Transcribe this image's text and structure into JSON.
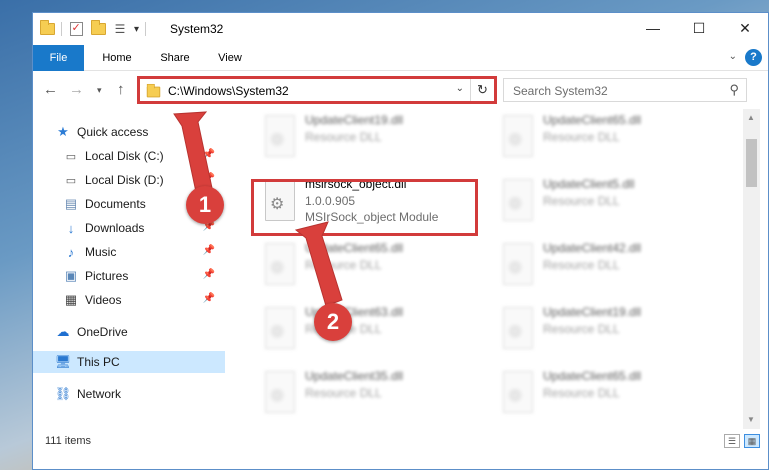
{
  "window": {
    "title": "System32",
    "controls": {
      "minimize": "—",
      "maximize": "☐",
      "close": "✕"
    }
  },
  "ribbon": {
    "tabs": [
      "File",
      "Home",
      "Share",
      "View"
    ],
    "help": "?"
  },
  "navigation": {
    "address_path": "C:\\Windows\\System32",
    "search_placeholder": "Search System32"
  },
  "sidebar": {
    "items": [
      {
        "label": "Quick access",
        "icon": "star-icon"
      },
      {
        "label": "Local Disk (C:)",
        "icon": "drive-icon",
        "pinned": true
      },
      {
        "label": "Local Disk (D:)",
        "icon": "drive-icon",
        "pinned": true
      },
      {
        "label": "Documents",
        "icon": "documents-icon",
        "pinned": true
      },
      {
        "label": "Downloads",
        "icon": "download-icon",
        "pinned": true
      },
      {
        "label": "Music",
        "icon": "music-icon",
        "pinned": true
      },
      {
        "label": "Pictures",
        "icon": "pictures-icon",
        "pinned": true
      },
      {
        "label": "Videos",
        "icon": "videos-icon",
        "pinned": true
      },
      {
        "label": "OneDrive",
        "icon": "cloud-icon"
      },
      {
        "label": "This PC",
        "icon": "computer-icon",
        "selected": true
      },
      {
        "label": "Network",
        "icon": "network-icon"
      }
    ]
  },
  "files": {
    "left_column": [
      {
        "name": "UpdateClient19.dll",
        "type": "Resource DLL"
      },
      {
        "name": "msirsock_object.dll",
        "version": "1.0.0.905",
        "desc": "MSIrSock_object Module"
      },
      {
        "name": "UpdateClient65.dll",
        "type": "Resource DLL"
      },
      {
        "name": "UpdateClient63.dll",
        "type": "Resource DLL"
      },
      {
        "name": "UpdateClient35.dll",
        "type": "Resource DLL"
      }
    ],
    "right_column": [
      {
        "name": "UpdateClient65.dll",
        "type": "Resource DLL"
      },
      {
        "name": "UpdateClient5.dll",
        "type": "Resource DLL"
      },
      {
        "name": "UpdateClient42.dll",
        "type": "Resource DLL"
      },
      {
        "name": "UpdateClient19.dll",
        "type": "Resource DLL"
      },
      {
        "name": "UpdateClient65.dll",
        "type": "Resource DLL"
      }
    ]
  },
  "status": {
    "item_count": "111 items"
  },
  "callouts": {
    "first": "1",
    "second": "2"
  },
  "colors": {
    "accent": "#1979ca",
    "highlight": "#d23b3b",
    "selected": "#cce8ff"
  }
}
